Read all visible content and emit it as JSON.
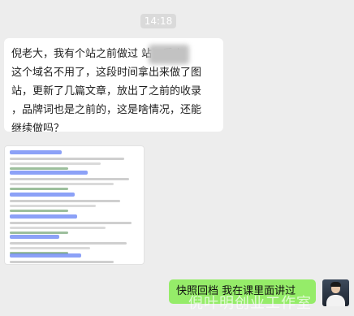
{
  "timestamp": "14:18",
  "incoming_message": {
    "text": "倪老大，我有个站之前做过 站，后来\n这个域名不用了，这段时间拿出来做了图\n站，更新了几篇文章，放出了之前的收录\n，品牌词也是之前的，这是啥情况，还能\n继续做吗？"
  },
  "image_attachment": {
    "description": "search results screenshot",
    "results": 6
  },
  "outgoing_message": {
    "text": "快照回档 我在课里面讲过"
  },
  "watermark": "倪叶明创业工作室",
  "colors": {
    "background": "#ededed",
    "incoming_bubble": "#ffffff",
    "outgoing_bubble": "#95ec69",
    "link_blue": "#4e6ef2"
  }
}
